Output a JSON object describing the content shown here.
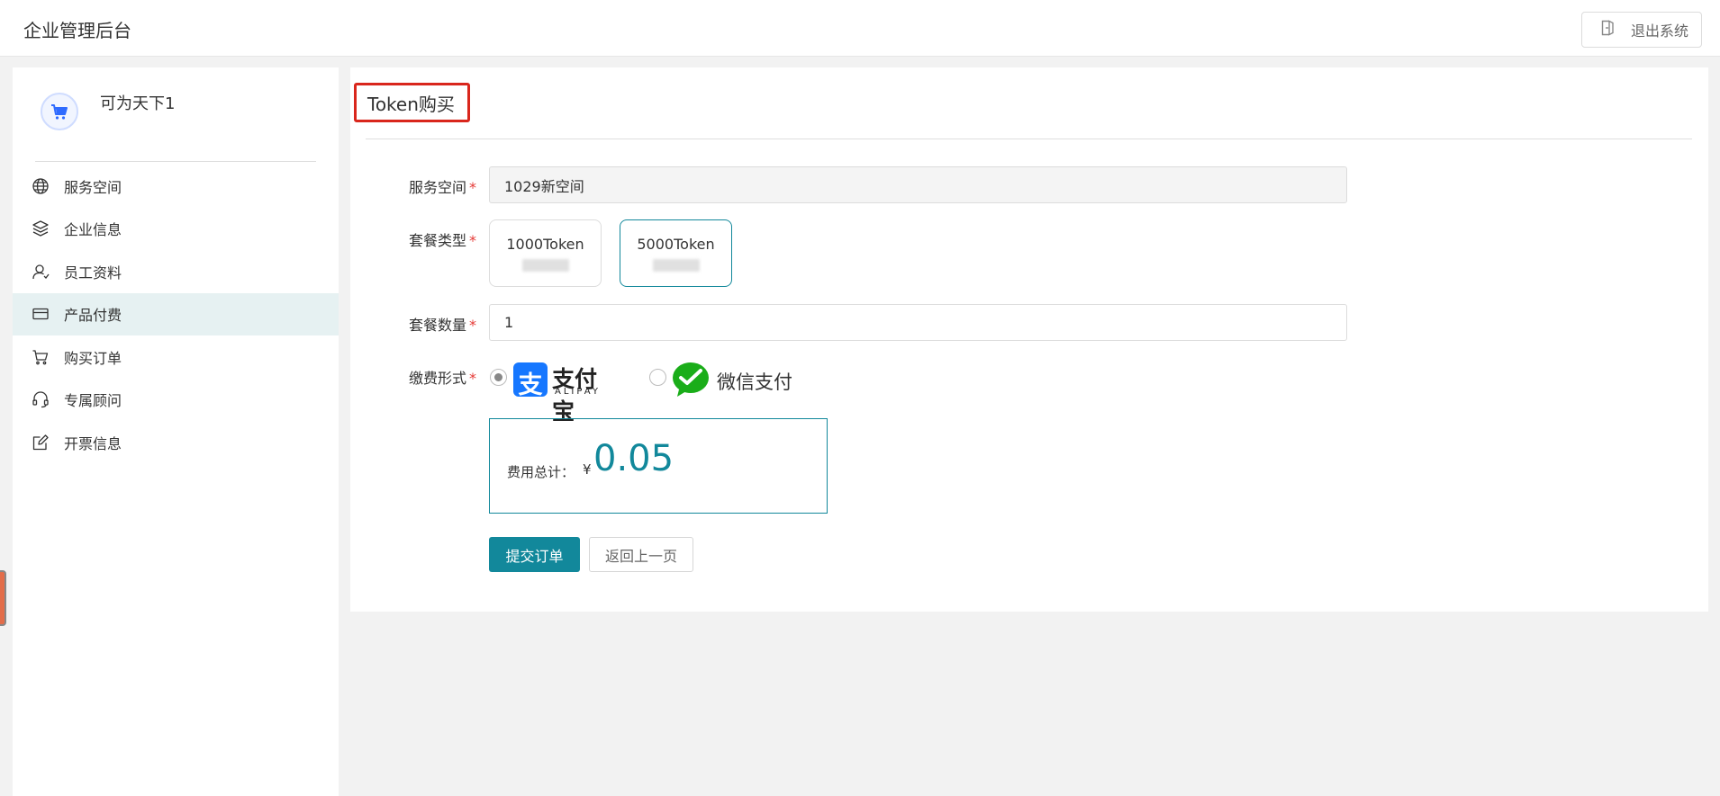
{
  "app": {
    "title": "企业管理后台",
    "logout_label": "退出系统"
  },
  "sidebar": {
    "org_name": "可为天下1",
    "items": [
      {
        "label": "服务空间",
        "icon": "globe-icon"
      },
      {
        "label": "企业信息",
        "icon": "layers-icon"
      },
      {
        "label": "员工资料",
        "icon": "user-icon"
      },
      {
        "label": "产品付费",
        "icon": "credit-card-icon",
        "active": true
      },
      {
        "label": "购买订单",
        "icon": "cart-icon"
      },
      {
        "label": "专属顾问",
        "icon": "headset-icon"
      },
      {
        "label": "开票信息",
        "icon": "edit-icon"
      }
    ]
  },
  "page": {
    "title": "Token购买"
  },
  "form": {
    "service_space": {
      "label": "服务空间",
      "value": "1029新空间"
    },
    "package_type": {
      "label": "套餐类型",
      "options": [
        {
          "name": "1000Token",
          "selected": false
        },
        {
          "name": "5000Token",
          "selected": true
        }
      ]
    },
    "package_quantity": {
      "label": "套餐数量",
      "value": "1"
    },
    "payment_method": {
      "label": "缴费形式",
      "options": [
        {
          "name": "alipay",
          "logo_cn": "支付宝",
          "logo_en": "ALIPAY",
          "mark": "支",
          "checked": true
        },
        {
          "name": "wechat",
          "label": "微信支付",
          "checked": false
        }
      ]
    },
    "total": {
      "label": "费用总计：",
      "currency": "¥",
      "amount": "0.05"
    },
    "submit_label": "提交订单",
    "back_label": "返回上一页"
  },
  "colors": {
    "accent": "#12889b",
    "active_menu_bg": "#e6f1f2",
    "highlight_border": "#d9261c",
    "alipay_blue": "#1677ff",
    "wechat_green": "#1aad19"
  }
}
